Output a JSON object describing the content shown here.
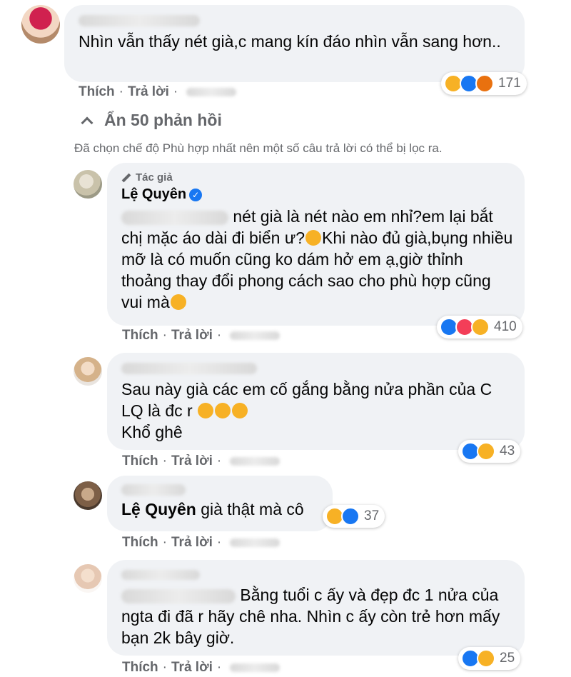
{
  "comments": [
    {
      "text": "Nhìn vẫn thấy nét già,c mang kín đáo nhìn vẫn sang hơn..",
      "like": "Thích",
      "reply": "Trả lời",
      "reaction_count": "171"
    }
  ],
  "hide_replies": {
    "label": "Ẩn 50 phản hồi"
  },
  "filter_notice": "Đã chọn chế độ Phù hợp nhất nên một số câu trả lời có thể bị lọc ra.",
  "replies": [
    {
      "author_tag": "Tác giả",
      "author": "Lệ Quyên",
      "text": "nét già là nét nào em nhỉ?em lại bắt chị mặc áo dài đi biển ư?",
      "text2": "Khi nào đủ già,bụng nhiều mỡ là có muốn cũng ko dám hở em ạ,giờ thỉnh thoảng thay đổi phong cách sao cho phù hợp cũng vui mà",
      "like": "Thích",
      "reply": "Trả lời",
      "reaction_count": "410"
    },
    {
      "text": "Sau này già các em cố gắng bằng nửa phần của C LQ là đc r",
      "text2": "Khổ ghê",
      "like": "Thích",
      "reply": "Trả lời",
      "reaction_count": "43"
    },
    {
      "mention": "Lệ Quyên",
      "text": "già thật mà cô",
      "like": "Thích",
      "reply": "Trả lời",
      "reaction_count": "37"
    },
    {
      "text": "Bằng tuổi c ấy và đẹp đc 1 nửa của ngta đi đã r hãy chê nha. Nhìn c ấy còn trẻ hơn mấy bạn 2k bây giờ.",
      "like": "Thích",
      "reply": "Trả lời",
      "reaction_count": "25"
    }
  ],
  "colors": {
    "bubble": "#f0f2f5",
    "secondary": "#65676b",
    "like": "#1877f2",
    "haha": "#f7b125"
  }
}
